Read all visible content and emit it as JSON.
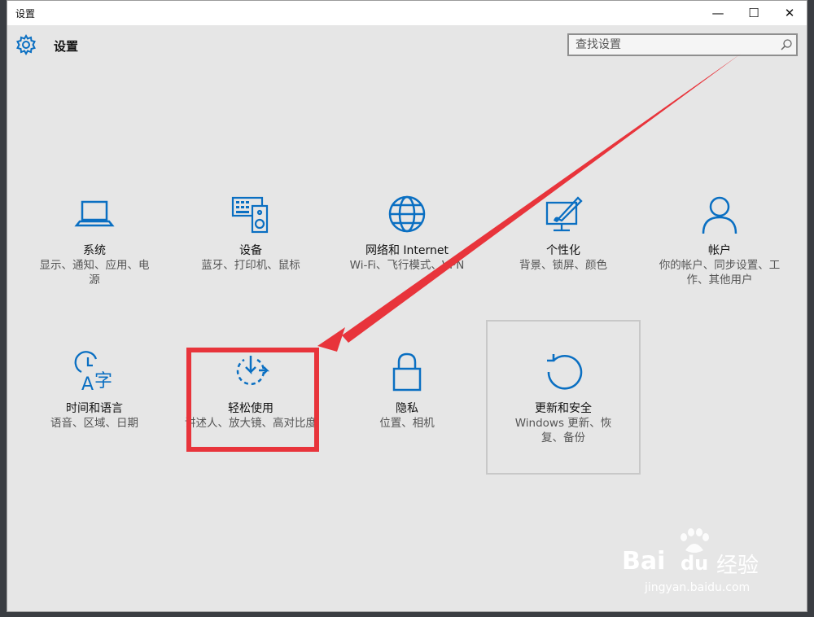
{
  "window": {
    "title": "设置",
    "controls": {
      "minimize": "—",
      "maximize": "☐",
      "close": "✕"
    }
  },
  "header": {
    "title": "设置",
    "icon": "gear-icon",
    "search": {
      "placeholder": "查找设置",
      "value": "",
      "icon": "search-icon"
    }
  },
  "categories": [
    {
      "name": "系统",
      "desc": "显示、通知、应用、电源",
      "icon": "laptop-icon"
    },
    {
      "name": "设备",
      "desc": "蓝牙、打印机、鼠标",
      "icon": "devices-icon"
    },
    {
      "name": "网络和 Internet",
      "desc": "Wi-Fi、飞行模式、VPN",
      "icon": "globe-icon"
    },
    {
      "name": "个性化",
      "desc": "背景、锁屏、颜色",
      "icon": "personalization-icon"
    },
    {
      "name": "帐户",
      "desc": "你的帐户、同步设置、工作、其他用户",
      "icon": "user-icon"
    },
    {
      "name": "时间和语言",
      "desc": "语音、区域、日期",
      "icon": "time-language-icon"
    },
    {
      "name": "轻松使用",
      "desc": "讲述人、放大镜、高对比度",
      "icon": "ease-of-access-icon"
    },
    {
      "name": "隐私",
      "desc": "位置、相机",
      "icon": "lock-icon"
    },
    {
      "name": "更新和安全",
      "desc": "Windows 更新、恢复、备份",
      "icon": "update-icon"
    }
  ],
  "colors": {
    "accent": "#0a6fc2",
    "annotation": "#e8343b",
    "background": "#e6e6e6"
  },
  "watermark": {
    "brand": "Bai",
    "brand2": "du",
    "label": "经验",
    "url": "jingyan.baidu.com"
  }
}
